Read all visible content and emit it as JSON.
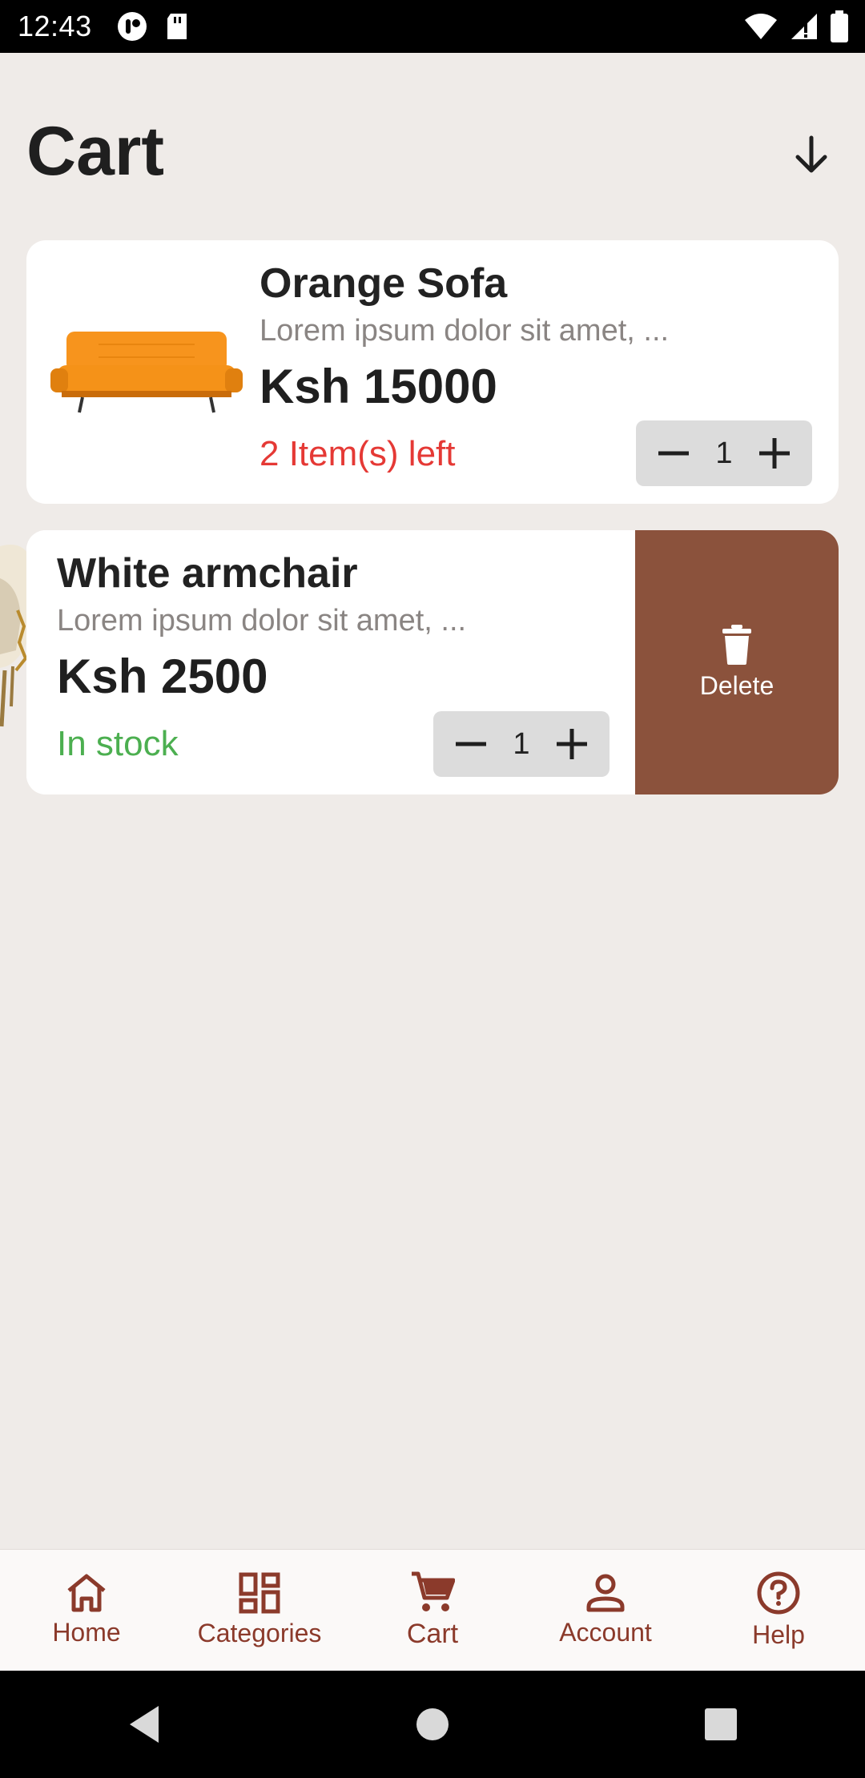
{
  "status_bar": {
    "time": "12:43"
  },
  "header": {
    "title": "Cart"
  },
  "cart_items": [
    {
      "title": "Orange Sofa",
      "description": "Lorem ipsum dolor sit amet, ...",
      "price": "Ksh 15000",
      "stock": "2 Item(s) left",
      "quantity": "1",
      "stock_color": "#e53935"
    },
    {
      "title": "White armchair",
      "description": "Lorem ipsum dolor sit amet, ...",
      "price": "Ksh 2500",
      "stock": "In stock",
      "quantity": "1",
      "stock_color": "#4caf50",
      "swipe_action": "Delete"
    }
  ],
  "bottom_nav": {
    "items": [
      {
        "label": "Home",
        "icon": "home-icon"
      },
      {
        "label": "Categories",
        "icon": "categories-icon"
      },
      {
        "label": "Cart",
        "icon": "cart-icon",
        "active": true
      },
      {
        "label": "Account",
        "icon": "account-icon"
      },
      {
        "label": "Help",
        "icon": "help-icon"
      }
    ]
  },
  "colors": {
    "accent": "#8b3a2b",
    "delete_bg": "#8b523c",
    "background": "#efebe8"
  }
}
